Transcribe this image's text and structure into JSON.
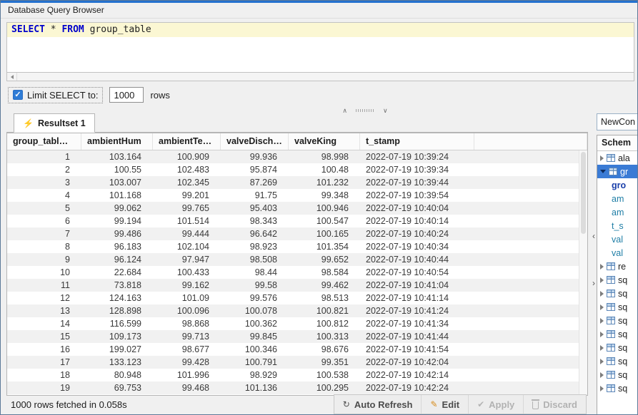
{
  "window": {
    "title": "Database Query Browser"
  },
  "editor": {
    "sql": {
      "keyword1": "SELECT",
      "middle": " * ",
      "keyword2": "FROM",
      "rest": " group_table"
    }
  },
  "limit": {
    "label": "Limit SELECT to:",
    "value": "1000",
    "suffix": "rows"
  },
  "resultset": {
    "tab_label": "Resultset 1",
    "bolt_icon": "⚡",
    "columns": [
      "group_tabl…",
      "ambientHum",
      "ambientTe…",
      "valveDisch…",
      "valveKing",
      "t_stamp"
    ],
    "rows": [
      [
        "1",
        "103.164",
        "100.909",
        "99.936",
        "98.998",
        "2022-07-19 10:39:24"
      ],
      [
        "2",
        "100.55",
        "102.483",
        "95.874",
        "100.48",
        "2022-07-19 10:39:34"
      ],
      [
        "3",
        "103.007",
        "102.345",
        "87.269",
        "101.232",
        "2022-07-19 10:39:44"
      ],
      [
        "4",
        "101.168",
        "99.201",
        "91.75",
        "99.348",
        "2022-07-19 10:39:54"
      ],
      [
        "5",
        "99.062",
        "99.765",
        "95.403",
        "100.946",
        "2022-07-19 10:40:04"
      ],
      [
        "6",
        "99.194",
        "101.514",
        "98.343",
        "100.547",
        "2022-07-19 10:40:14"
      ],
      [
        "7",
        "99.486",
        "99.444",
        "96.642",
        "100.165",
        "2022-07-19 10:40:24"
      ],
      [
        "8",
        "96.183",
        "102.104",
        "98.923",
        "101.354",
        "2022-07-19 10:40:34"
      ],
      [
        "9",
        "96.124",
        "97.947",
        "98.508",
        "99.652",
        "2022-07-19 10:40:44"
      ],
      [
        "10",
        "22.684",
        "100.433",
        "98.44",
        "98.584",
        "2022-07-19 10:40:54"
      ],
      [
        "11",
        "73.818",
        "99.162",
        "99.58",
        "99.462",
        "2022-07-19 10:41:04"
      ],
      [
        "12",
        "124.163",
        "101.09",
        "99.576",
        "98.513",
        "2022-07-19 10:41:14"
      ],
      [
        "13",
        "128.898",
        "100.096",
        "100.078",
        "100.821",
        "2022-07-19 10:41:24"
      ],
      [
        "14",
        "116.599",
        "98.868",
        "100.362",
        "100.812",
        "2022-07-19 10:41:34"
      ],
      [
        "15",
        "109.173",
        "99.713",
        "99.845",
        "100.313",
        "2022-07-19 10:41:44"
      ],
      [
        "16",
        "199.027",
        "98.677",
        "100.346",
        "98.676",
        "2022-07-19 10:41:54"
      ],
      [
        "17",
        "133.123",
        "99.428",
        "100.791",
        "99.351",
        "2022-07-19 10:42:04"
      ],
      [
        "18",
        "80.948",
        "101.996",
        "98.929",
        "100.538",
        "2022-07-19 10:42:14"
      ],
      [
        "19",
        "69.753",
        "99.468",
        "101.136",
        "100.295",
        "2022-07-19 10:42:24"
      ]
    ]
  },
  "statusbar": {
    "text": "1000 rows fetched in 0.058s",
    "buttons": [
      {
        "label": "Auto Refresh",
        "icon": "refresh-icon",
        "enabled": true
      },
      {
        "label": "Edit",
        "icon": "pencil-icon",
        "enabled": true
      },
      {
        "label": "Apply",
        "icon": "check-icon",
        "enabled": false
      },
      {
        "label": "Discard",
        "icon": "trash-icon",
        "enabled": false
      }
    ]
  },
  "right_panel": {
    "connection": "NewCon",
    "schema_header": "Schem",
    "tree": [
      {
        "label": "ala",
        "kind": "table",
        "level": 0,
        "expanded": false,
        "selected": false
      },
      {
        "label": "gr",
        "kind": "table",
        "level": 0,
        "expanded": true,
        "selected": true
      },
      {
        "label": "gro",
        "kind": "column",
        "level": 1,
        "style": "pk"
      },
      {
        "label": "am",
        "kind": "column",
        "level": 1,
        "style": "col"
      },
      {
        "label": "am",
        "kind": "column",
        "level": 1,
        "style": "col"
      },
      {
        "label": "t_s",
        "kind": "column",
        "level": 1,
        "style": "col"
      },
      {
        "label": "val",
        "kind": "column",
        "level": 1,
        "style": "col"
      },
      {
        "label": "val",
        "kind": "column",
        "level": 1,
        "style": "col"
      },
      {
        "label": "re",
        "kind": "table",
        "level": 0,
        "expanded": false,
        "selected": false
      },
      {
        "label": "sq",
        "kind": "table",
        "level": 0,
        "expanded": false,
        "selected": false
      },
      {
        "label": "sq",
        "kind": "table",
        "level": 0,
        "expanded": false,
        "selected": false
      },
      {
        "label": "sq",
        "kind": "table",
        "level": 0,
        "expanded": false,
        "selected": false
      },
      {
        "label": "sq",
        "kind": "table",
        "level": 0,
        "expanded": false,
        "selected": false
      },
      {
        "label": "sq",
        "kind": "table",
        "level": 0,
        "expanded": false,
        "selected": false
      },
      {
        "label": "sq",
        "kind": "table",
        "level": 0,
        "expanded": false,
        "selected": false
      },
      {
        "label": "sq",
        "kind": "table",
        "level": 0,
        "expanded": false,
        "selected": false
      },
      {
        "label": "sq",
        "kind": "table",
        "level": 0,
        "expanded": false,
        "selected": false
      },
      {
        "label": "sq",
        "kind": "table",
        "level": 0,
        "expanded": false,
        "selected": false
      }
    ]
  },
  "splitter": {
    "collapse_left": "‹",
    "collapse_right": "›",
    "up": "∧",
    "down": "∨"
  }
}
